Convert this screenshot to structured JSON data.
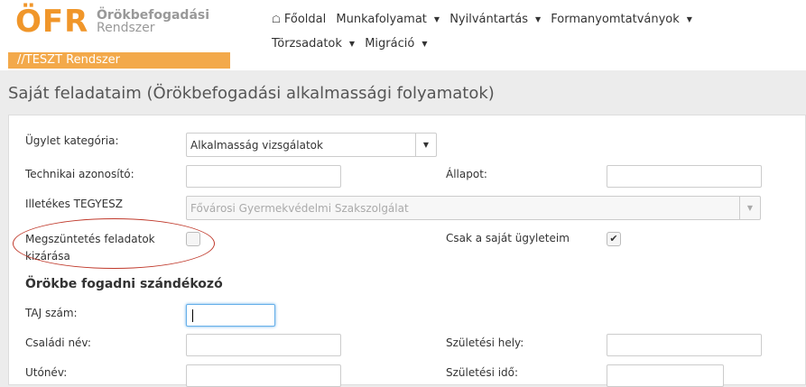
{
  "header": {
    "logo": "ÖFR",
    "logo_sub1": "Örökbefogadási",
    "logo_sub2": "Rendszer",
    "environment": "//TESZT Rendszer"
  },
  "nav": {
    "home": "Főoldal",
    "items": [
      "Munkafolyamat",
      "Nyilvántartás",
      "Formanyomtatványok",
      "Törzsadatok",
      "Migráció"
    ]
  },
  "page_title": "Saját feladataim (Örökbefogadási alkalmassági folyamatok)",
  "form": {
    "ugylet_label": "Ügylet kategória:",
    "ugylet_value": "Alkalmasság vizsgálatok",
    "tech_azon_label": "Technikai azonosító:",
    "tech_azon_value": "",
    "allapot_label": "Állapot:",
    "allapot_value": "",
    "tegyesz_label": "Illetékes TEGYESZ",
    "tegyesz_value": "Fővárosi Gyermekvédelmi Szakszolgálat",
    "megszunt_label_1": "Megszüntetés feladatok",
    "megszunt_label_2": "kizárása",
    "megszunt_checked": false,
    "sajat_label": "Csak a saját ügyleteim",
    "sajat_checked": true,
    "section_title": "Örökbe fogadni szándékozó",
    "taj_label": "TAJ szám:",
    "taj_value": "",
    "csaladi_label": "Családi név:",
    "szulhely_label": "Születési hely:",
    "utonev_label": "Utónév:",
    "szulido_label": "Születési idő:"
  }
}
